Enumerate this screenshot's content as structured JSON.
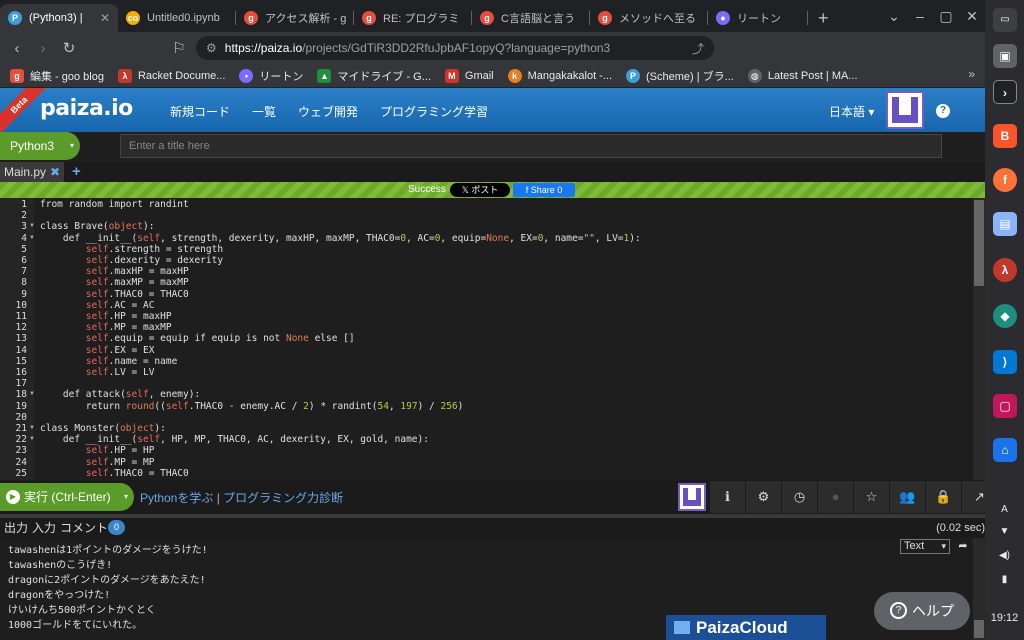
{
  "browser": {
    "tabs": [
      {
        "title": "(Python3) | ",
        "icon": "paiza-icon",
        "color": "#3aa0d8",
        "active": true
      },
      {
        "title": "Untitled0.ipynb",
        "icon": "colab-icon",
        "color": "#f9ab00"
      },
      {
        "title": "アクセス解析 - g",
        "icon": "goo-icon",
        "color": "#e74c3c"
      },
      {
        "title": "RE: プログラミ",
        "icon": "goo-icon",
        "color": "#e74c3c"
      },
      {
        "title": "C言語脳と言う",
        "icon": "goo-icon",
        "color": "#e74c3c"
      },
      {
        "title": "メソッドへ至る",
        "icon": "goo-icon",
        "color": "#e74c3c"
      },
      {
        "title": "リートン",
        "icon": "wrtn-icon",
        "color": "#7b6cff"
      }
    ],
    "url_host": "https://paiza.io",
    "url_path": "/projects/GdTiR3DD2RfuJpbAF1opyQ?language=python3",
    "brave_count": "5",
    "alert_count": "1",
    "bookmarks": [
      {
        "label": "編集 - goo blog",
        "icon": "goo-icon",
        "color": "#e74c3c"
      },
      {
        "label": "Racket Docume...",
        "icon": "racket-icon",
        "color": "#c0392b"
      },
      {
        "label": "リートン",
        "icon": "wrtn-icon",
        "color": "#7b6cff"
      },
      {
        "label": "マイドライブ - G...",
        "icon": "drive-icon",
        "color": "#1e8e3e"
      },
      {
        "label": "Gmail",
        "icon": "gmail-icon",
        "color": "#d93025"
      },
      {
        "label": "Mangakakalot -...",
        "icon": "manga-icon",
        "color": "#e67e22"
      },
      {
        "label": "(Scheme) | ブラ...",
        "icon": "paiza-icon",
        "color": "#3aa0d8"
      },
      {
        "label": "Latest Post | MA...",
        "icon": "globe-icon",
        "color": "#5f6368"
      }
    ]
  },
  "paiza": {
    "beta": "Beta",
    "logo": "paiza.io",
    "nav": [
      "新規コード",
      "一覧",
      "ウェブ開発",
      "プログラミング学習"
    ],
    "language_menu": "日本語 ▾",
    "language": "Python3",
    "title_placeholder": "Enter a title here",
    "file_tab": "Main.py",
    "status": "Success",
    "x_post": "𝕏 ポスト",
    "fb_share": "f Share 0",
    "run_label": "実行 (Ctrl-Enter)",
    "learn_link": "Pythonを学ぶ",
    "sep": " | ",
    "diag_link": "プログラミング力診断",
    "io_tabs": [
      "出力",
      "入力",
      "コメント"
    ],
    "comment_count": "0",
    "exec_time": "(0.02 sec)",
    "output_format": "Text",
    "cloud": "PaizaCloud",
    "help": "ヘルプ"
  },
  "code": [
    "from random import randint",
    "",
    "class Brave(object):",
    "    def __init__(self, strength, dexerity, maxHP, maxMP, THAC0=0, AC=0, equip=None, EX=0, name=\"\", LV=1):",
    "        self.strength = strength",
    "        self.dexerity = dexerity",
    "        self.maxHP = maxHP",
    "        self.maxMP = maxMP",
    "        self.THAC0 = THAC0",
    "        self.AC = AC",
    "        self.HP = maxHP",
    "        self.MP = maxMP",
    "        self.equip = equip if equip is not None else []",
    "        self.EX = EX",
    "        self.name = name",
    "        self.LV = LV",
    "",
    "    def attack(self, enemy):",
    "        return round((self.THAC0 - enemy.AC / 2) * randint(54, 197) / 256)",
    "",
    "class Monster(object):",
    "    def __init__(self, HP, MP, THAC0, AC, dexerity, EX, gold, name):",
    "        self.HP = HP",
    "        self.MP = MP",
    "        self.THAC0 = THAC0"
  ],
  "output": [
    "tawashenは1ポイントのダメージをうけた!",
    "tawashenのこうげき!",
    "dragonに2ポイントのダメージをあたえた!",
    "dragonをやっつけた!",
    "けいけんち500ポイントかくとく",
    "1000ゴールドをてにいれた。"
  ],
  "shelf": {
    "lang": "A",
    "time": "19:12"
  }
}
